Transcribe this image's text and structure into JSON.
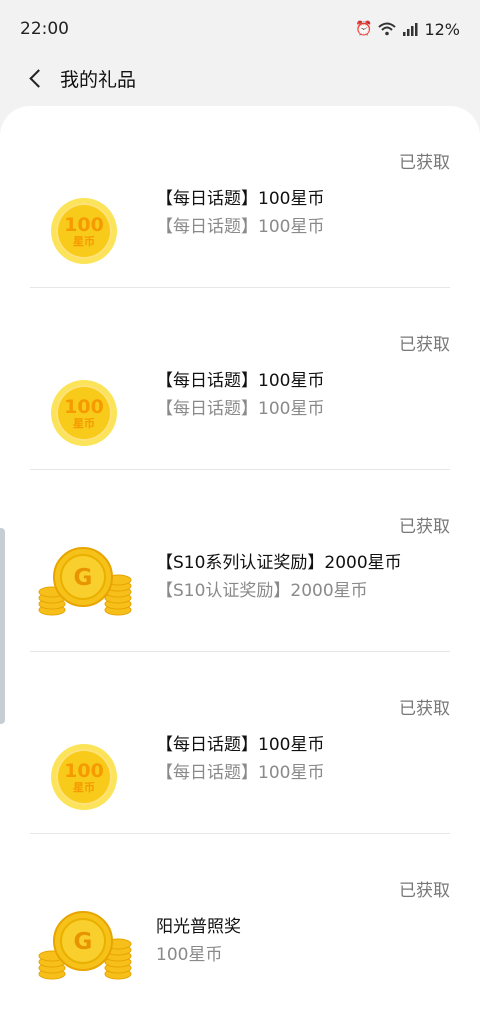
{
  "status_bar": {
    "time": "22:00",
    "battery": "12%"
  },
  "header": {
    "title": "我的礼品"
  },
  "items": [
    {
      "status": "已获取",
      "title": "【每日话题】100星币",
      "subtitle": "【每日话题】100星币",
      "coin": {
        "number": "100",
        "unit": "星币"
      }
    },
    {
      "status": "已获取",
      "title": "【每日话题】100星币",
      "subtitle": "【每日话题】100星币",
      "coin": {
        "number": "100",
        "unit": "星币"
      }
    },
    {
      "status": "已获取",
      "title": "【S10系列认证奖励】2000星币",
      "subtitle": "【S10认证奖励】2000星币",
      "coin": {
        "letter": "G"
      }
    },
    {
      "status": "已获取",
      "title": "【每日话题】100星币",
      "subtitle": "【每日话题】100星币",
      "coin": {
        "number": "100",
        "unit": "星币"
      }
    },
    {
      "status": "已获取",
      "title": "阳光普照奖",
      "subtitle": "100星币",
      "coin": {
        "letter": "G"
      }
    }
  ],
  "icons": [
    "back-arrow-icon",
    "alarm-icon",
    "wifi-icon",
    "signal-icon",
    "coin-100-icon",
    "gold-coin-stack-icon"
  ],
  "colors": {
    "background": "#f2f2f2",
    "card": "#ffffff",
    "status_text": "#777777",
    "coin_gold": "#f8cb1a"
  }
}
